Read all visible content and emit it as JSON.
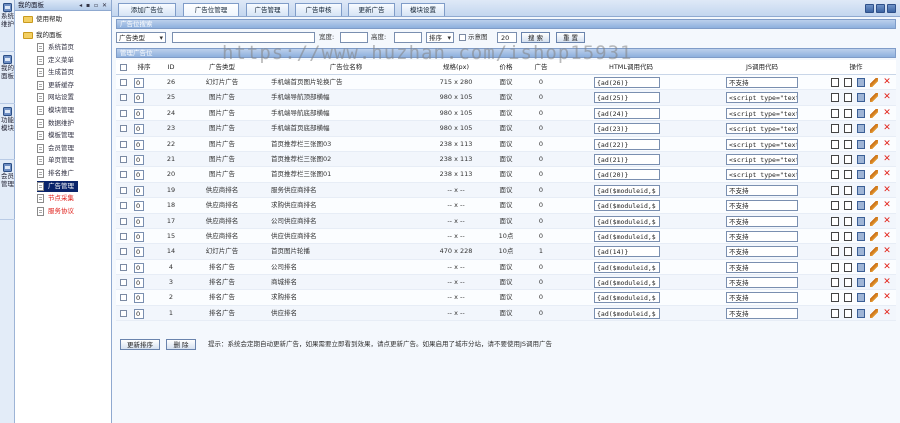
{
  "side_tabs": [
    {
      "label": "系统维护",
      "icon": "tools-icon"
    },
    {
      "label": "我的面板",
      "icon": "home-icon"
    },
    {
      "label": "功能模块",
      "icon": "modules-icon"
    },
    {
      "label": "会员管理",
      "icon": "users-icon"
    }
  ],
  "tree": {
    "title": "我的面板",
    "folders": [
      "使用帮助",
      "我的面板"
    ],
    "items": [
      "系统首页",
      "定义菜单",
      "生成首页",
      "更新缓存",
      "网站设置",
      "模块管理",
      "数据维护",
      "模板管理",
      "会员管理",
      "单页管理",
      "排名推广",
      "广告管理",
      "节点采集",
      "服务协议"
    ],
    "selected": "广告管理",
    "red_items": [
      "节点采集",
      "服务协议"
    ]
  },
  "top_tabs": [
    "添加广告位",
    "广告位管理",
    "广告管理",
    "广告审核",
    "更新广告",
    "模块设置"
  ],
  "active_tab": "广告位管理",
  "search": {
    "bar_title": "广告位搜索",
    "type_select": "广告类型",
    "width_label": "宽度:",
    "height_label": "高度:",
    "sort_select": "排序",
    "show_label": "示意图",
    "page_size": "20",
    "search_button": "搜 索",
    "reset_button": "重 置"
  },
  "list": {
    "bar_title": "管理广告位",
    "columns": [
      "排序",
      "ID",
      "广告类型",
      "广告位名称",
      "规格(px)",
      "价格",
      "广告",
      "HTML调用代码",
      "JS调用代码",
      "操作"
    ],
    "rows": [
      {
        "order": "0",
        "id": "26",
        "type": "幻灯片广告",
        "name": "手机端首页图片轮换广告",
        "size": "715 x 280",
        "price": "面议",
        "ads": "0",
        "html": "{ad(26)}",
        "js": "不支持"
      },
      {
        "order": "0",
        "id": "25",
        "type": "图片广告",
        "name": "手机端导航顶部横幅",
        "size": "980 x 105",
        "price": "面议",
        "ads": "0",
        "html": "{ad(25)}",
        "js": "<script type=\"text"
      },
      {
        "order": "0",
        "id": "24",
        "type": "图片广告",
        "name": "手机端导航底部横幅",
        "size": "980 x 105",
        "price": "面议",
        "ads": "0",
        "html": "{ad(24)}",
        "js": "<script type=\"text"
      },
      {
        "order": "0",
        "id": "23",
        "type": "图片广告",
        "name": "手机端首页底部横幅",
        "size": "980 x 105",
        "price": "面议",
        "ads": "0",
        "html": "{ad(23)}",
        "js": "<script type=\"text"
      },
      {
        "order": "0",
        "id": "22",
        "type": "图片广告",
        "name": "首页推荐栏三张图03",
        "size": "238 x 113",
        "price": "面议",
        "ads": "0",
        "html": "{ad(22)}",
        "js": "<script type=\"text"
      },
      {
        "order": "0",
        "id": "21",
        "type": "图片广告",
        "name": "首页推荐栏三张图02",
        "size": "238 x 113",
        "price": "面议",
        "ads": "0",
        "html": "{ad(21)}",
        "js": "<script type=\"text"
      },
      {
        "order": "0",
        "id": "20",
        "type": "图片广告",
        "name": "首页推荐栏三张图01",
        "size": "238 x 113",
        "price": "面议",
        "ads": "0",
        "html": "{ad(20)}",
        "js": "<script type=\"text"
      },
      {
        "order": "0",
        "id": "19",
        "type": "供应商排名",
        "name": "服务供应商排名",
        "size": "-- x --",
        "price": "面议",
        "ads": "0",
        "html": "{ad($moduleid,$",
        "js": "不支持"
      },
      {
        "order": "0",
        "id": "18",
        "type": "供应商排名",
        "name": "求购供应商排名",
        "size": "-- x --",
        "price": "面议",
        "ads": "0",
        "html": "{ad($moduleid,$",
        "js": "不支持"
      },
      {
        "order": "0",
        "id": "17",
        "type": "供应商排名",
        "name": "公司供应商排名",
        "size": "-- x --",
        "price": "面议",
        "ads": "0",
        "html": "{ad($moduleid,$",
        "js": "不支持"
      },
      {
        "order": "0",
        "id": "15",
        "type": "供应商排名",
        "name": "供应供应商排名",
        "size": "-- x --",
        "price": "10点",
        "ads": "0",
        "html": "{ad($moduleid,$",
        "js": "不支持"
      },
      {
        "order": "0",
        "id": "14",
        "type": "幻灯片广告",
        "name": "首页图片轮播",
        "size": "470 x 228",
        "price": "10点",
        "ads": "1",
        "html": "{ad(14)}",
        "js": "不支持"
      },
      {
        "order": "0",
        "id": "4",
        "type": "排名广告",
        "name": "公司排名",
        "size": "-- x --",
        "price": "面议",
        "ads": "0",
        "html": "{ad($moduleid,$",
        "js": "不支持"
      },
      {
        "order": "0",
        "id": "3",
        "type": "排名广告",
        "name": "商城排名",
        "size": "-- x --",
        "price": "面议",
        "ads": "0",
        "html": "{ad($moduleid,$",
        "js": "不支持"
      },
      {
        "order": "0",
        "id": "2",
        "type": "排名广告",
        "name": "求购排名",
        "size": "-- x --",
        "price": "面议",
        "ads": "0",
        "html": "{ad($moduleid,$",
        "js": "不支持"
      },
      {
        "order": "0",
        "id": "1",
        "type": "排名广告",
        "name": "供应排名",
        "size": "-- x --",
        "price": "面议",
        "ads": "0",
        "html": "{ad($moduleid,$",
        "js": "不支持"
      }
    ]
  },
  "footer": {
    "update_button": "更新排序",
    "delete_button": "删 除",
    "hint": "提示：系统会定期自动更新广告，如果需要立即看到效果，请点更新广告。如果启用了城市分站，请不要使用JS调用广告"
  },
  "watermark": "https://www.huzhan.com/ishop15931"
}
